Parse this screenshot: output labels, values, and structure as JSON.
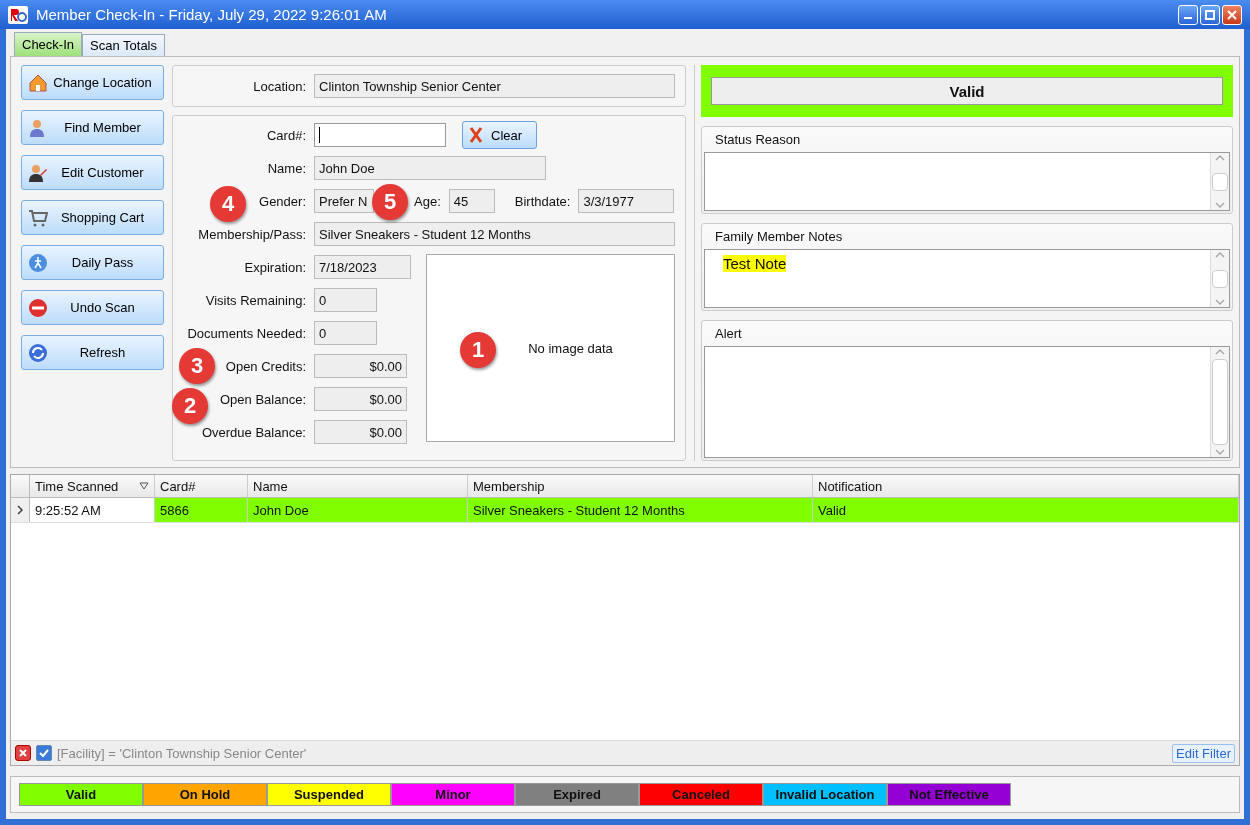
{
  "window": {
    "title": "Member Check-In - Friday, July 29, 2022 9:26:01 AM"
  },
  "tabs": [
    {
      "label": "Check-In",
      "selected": true
    },
    {
      "label": "Scan Totals",
      "selected": false
    }
  ],
  "sidebar": {
    "buttons": [
      {
        "label": "Change Location",
        "kind": "location"
      },
      {
        "label": "Find Member",
        "kind": "member"
      },
      {
        "label": "Edit Customer",
        "kind": "customer"
      },
      {
        "label": "Shopping Cart",
        "kind": "cart"
      },
      {
        "label": "Daily Pass",
        "kind": "pass"
      },
      {
        "label": "Undo Scan",
        "kind": "undo"
      },
      {
        "label": "Refresh",
        "kind": "refresh"
      }
    ]
  },
  "location": {
    "label": "Location:",
    "value": "Clinton Township Senior Center"
  },
  "card": {
    "label": "Card#:",
    "clear_button": "Clear"
  },
  "name": {
    "label": "Name:",
    "value": "John Doe"
  },
  "gender": {
    "label": "Gender:",
    "value": "Prefer N"
  },
  "age": {
    "label": "Age:",
    "value": "45"
  },
  "birthdate": {
    "label": "Birthdate:",
    "value": "3/3/1977"
  },
  "membership": {
    "label": "Membership/Pass:",
    "value": "Silver Sneakers - Student 12 Months"
  },
  "details": [
    {
      "label": "Expiration:",
      "value": "7/18/2023",
      "kind": "date"
    },
    {
      "label": "Visits Remaining:",
      "value": "0",
      "kind": "count"
    },
    {
      "label": "Documents Needed:",
      "value": "0",
      "kind": "count"
    },
    {
      "label": "Open Credits:",
      "value": "$0.00",
      "kind": "money"
    },
    {
      "label": "Open Balance:",
      "value": "$0.00",
      "kind": "money"
    },
    {
      "label": "Overdue Balance:",
      "value": "$0.00",
      "kind": "money"
    }
  ],
  "photo": {
    "text": "No image data"
  },
  "status": {
    "text": "Valid",
    "color": "#80ff00"
  },
  "panels": [
    {
      "title": "Status Reason"
    },
    {
      "title": "Family Member Notes",
      "lines": [
        {
          "text": "Test Note",
          "highlighted": true
        }
      ]
    },
    {
      "title": "Alert"
    }
  ],
  "grid": {
    "columns": [
      {
        "label": "Time Scanned",
        "sorted": true
      },
      {
        "label": "Card#",
        "sorted": false
      },
      {
        "label": "Name",
        "sorted": false
      },
      {
        "label": "Membership",
        "sorted": false
      },
      {
        "label": "Notification",
        "sorted": false
      }
    ],
    "rows": [
      {
        "current": true,
        "color": "#80ff00",
        "cells": [
          "9:25:52 AM",
          "5866",
          "John Doe",
          "Silver Sneakers - Student 12 Months",
          "Valid"
        ]
      }
    ]
  },
  "filter": {
    "enabled": true,
    "text": "[Facility] = 'Clinton Township Senior Center'",
    "edit_button": "Edit Filter"
  },
  "legend": [
    {
      "label": "Valid",
      "color": "#80ff00"
    },
    {
      "label": "On Hold",
      "color": "#ffa500"
    },
    {
      "label": "Suspended",
      "color": "#ffff00"
    },
    {
      "label": "Minor",
      "color": "#ff00ff"
    },
    {
      "label": "Expired",
      "color": "#808080"
    },
    {
      "label": "Canceled",
      "color": "#ff0000"
    },
    {
      "label": "Invalid Location",
      "color": "#00bfff"
    },
    {
      "label": "Not Effective",
      "color": "#9400d3"
    }
  ],
  "callouts": [
    "1",
    "2",
    "3",
    "4",
    "5"
  ]
}
